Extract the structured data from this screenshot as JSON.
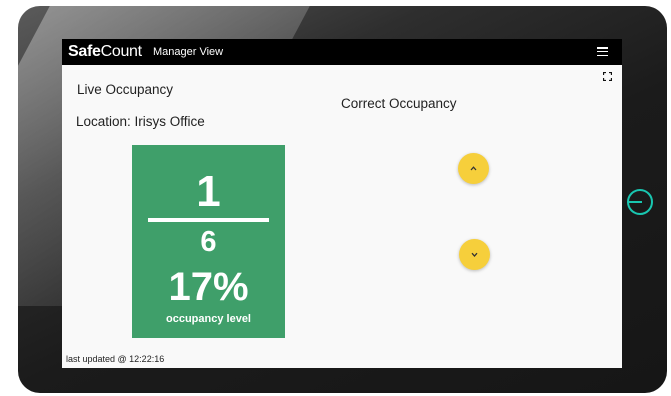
{
  "app": {
    "brand_bold": "Safe",
    "brand_rest": "Count",
    "view_title": "Manager View"
  },
  "icons": {
    "menu": "hamburger-menu-icon",
    "expand": "fullscreen-icon",
    "increment": "chevron-up-icon",
    "decrement": "chevron-down-icon",
    "power": "power-icon"
  },
  "main": {
    "live_occupancy_label": "Live Occupancy",
    "location_label": "Location: Irisys Office",
    "correct_occupancy_label": "Correct Occupancy"
  },
  "occupancy": {
    "current": "1",
    "capacity": "6",
    "percent": "17%",
    "level_label": "occupancy level"
  },
  "footer": {
    "last_updated": "last updated @ 12:22:16"
  },
  "colors": {
    "card_green": "#3f9f6a",
    "button_yellow": "#f6cf3b",
    "topbar": "#000000",
    "power_teal": "#19c6b0"
  }
}
